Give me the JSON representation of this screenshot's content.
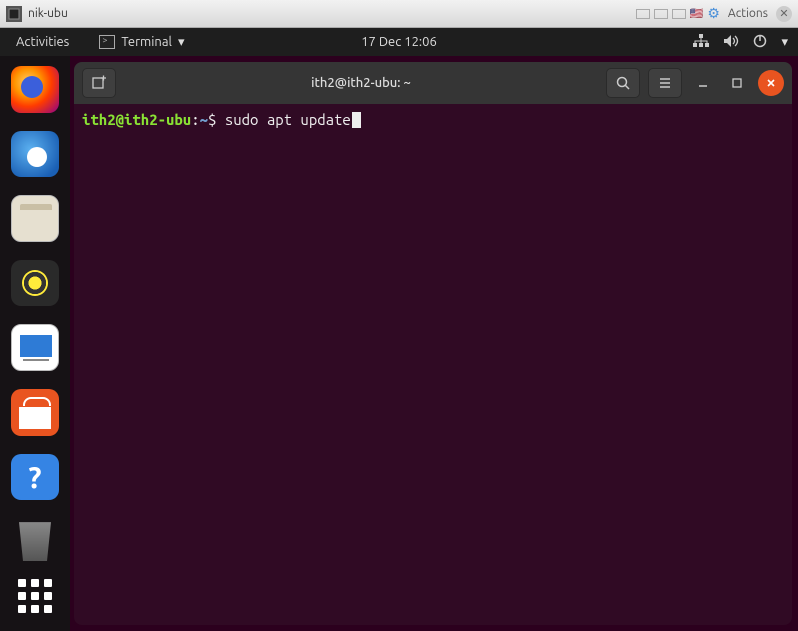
{
  "vm": {
    "title": "nik-ubu",
    "actions_label": "Actions"
  },
  "gnome": {
    "activities": "Activities",
    "app_menu": "Terminal",
    "datetime": "17 Dec  12:06"
  },
  "dock": {
    "items": [
      {
        "name": "firefox"
      },
      {
        "name": "thunderbird"
      },
      {
        "name": "files"
      },
      {
        "name": "rhythmbox"
      },
      {
        "name": "writer"
      },
      {
        "name": "software"
      },
      {
        "name": "help"
      }
    ]
  },
  "terminal": {
    "window_title": "ith2@ith2-ubu: ~",
    "prompt_user_host": "ith2@ith2-ubu",
    "prompt_sep": ":",
    "prompt_path": "~",
    "prompt_symbol": "$",
    "command": "sudo apt update"
  }
}
